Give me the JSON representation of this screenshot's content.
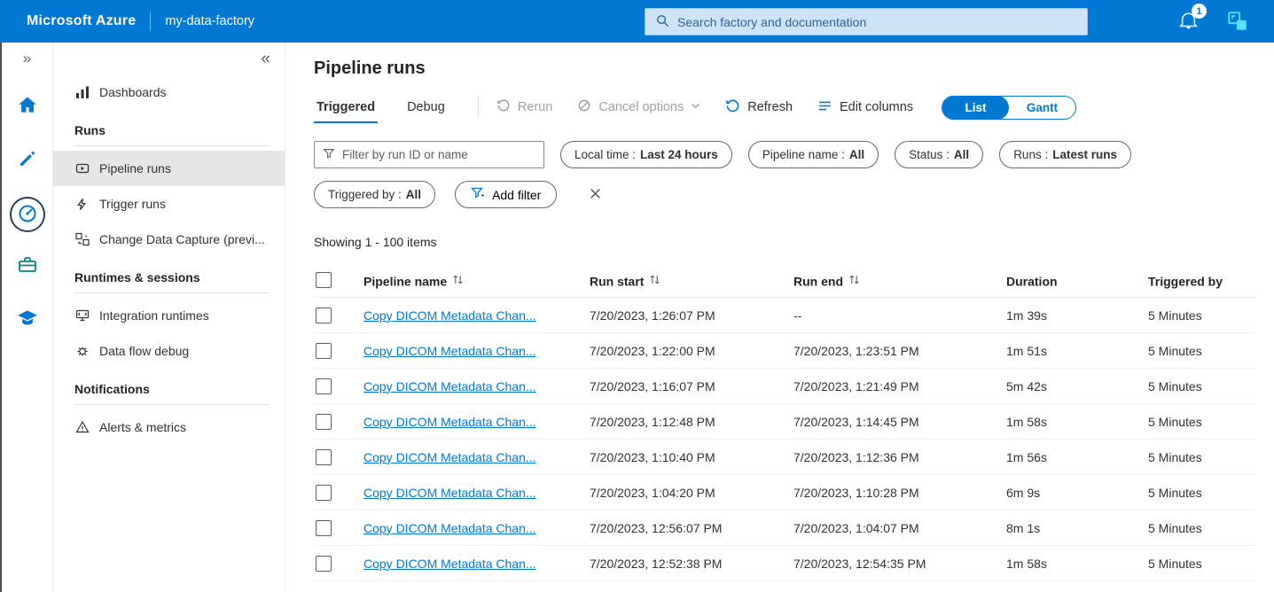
{
  "topbar": {
    "brand": "Microsoft Azure",
    "factory_name": "my-data-factory",
    "search_placeholder": "Search factory and documentation",
    "notification_badge": "1"
  },
  "icon_rail": {
    "expand_glyph": "»"
  },
  "sidebar": {
    "collapse_glyph": "«",
    "item_dashboards": "Dashboards",
    "section_runs": "Runs",
    "item_pipeline_runs": "Pipeline runs",
    "item_trigger_runs": "Trigger runs",
    "item_cdc": "Change Data Capture (previ...",
    "section_runtimes": "Runtimes & sessions",
    "item_integration_runtimes": "Integration runtimes",
    "item_data_flow_debug": "Data flow debug",
    "section_notifications": "Notifications",
    "item_alerts_metrics": "Alerts & metrics"
  },
  "main": {
    "title": "Pipeline runs",
    "tabs": {
      "triggered": "Triggered",
      "debug": "Debug"
    },
    "toolbar": {
      "rerun": "Rerun",
      "cancel_options": "Cancel options",
      "refresh": "Refresh",
      "edit_columns": "Edit columns",
      "view_list": "List",
      "view_gantt": "Gantt"
    },
    "filters": {
      "search_placeholder": "Filter by run ID or name",
      "pills": [
        {
          "label": "Local time :",
          "value": "Last 24 hours"
        },
        {
          "label": "Pipeline name :",
          "value": "All"
        },
        {
          "label": "Status :",
          "value": "All"
        },
        {
          "label": "Runs :",
          "value": "Latest runs"
        },
        {
          "label": "Triggered by :",
          "value": "All"
        }
      ],
      "add_filter": "Add filter"
    },
    "showing": "Showing 1 - 100 items",
    "table": {
      "headers": {
        "pipeline_name": "Pipeline name",
        "run_start": "Run start",
        "run_end": "Run end",
        "duration": "Duration",
        "triggered_by": "Triggered by"
      },
      "rows": [
        {
          "pipeline_name": "Copy DICOM Metadata Chan...",
          "run_start": "7/20/2023, 1:26:07 PM",
          "run_end": "--",
          "duration": "1m 39s",
          "triggered_by": "5 Minutes"
        },
        {
          "pipeline_name": "Copy DICOM Metadata Chan...",
          "run_start": "7/20/2023, 1:22:00 PM",
          "run_end": "7/20/2023, 1:23:51 PM",
          "duration": "1m 51s",
          "triggered_by": "5 Minutes"
        },
        {
          "pipeline_name": "Copy DICOM Metadata Chan...",
          "run_start": "7/20/2023, 1:16:07 PM",
          "run_end": "7/20/2023, 1:21:49 PM",
          "duration": "5m 42s",
          "triggered_by": "5 Minutes"
        },
        {
          "pipeline_name": "Copy DICOM Metadata Chan...",
          "run_start": "7/20/2023, 1:12:48 PM",
          "run_end": "7/20/2023, 1:14:45 PM",
          "duration": "1m 58s",
          "triggered_by": "5 Minutes"
        },
        {
          "pipeline_name": "Copy DICOM Metadata Chan...",
          "run_start": "7/20/2023, 1:10:40 PM",
          "run_end": "7/20/2023, 1:12:36 PM",
          "duration": "1m 56s",
          "triggered_by": "5 Minutes"
        },
        {
          "pipeline_name": "Copy DICOM Metadata Chan...",
          "run_start": "7/20/2023, 1:04:20 PM",
          "run_end": "7/20/2023, 1:10:28 PM",
          "duration": "6m 9s",
          "triggered_by": "5 Minutes"
        },
        {
          "pipeline_name": "Copy DICOM Metadata Chan...",
          "run_start": "7/20/2023, 12:56:07 PM",
          "run_end": "7/20/2023, 1:04:07 PM",
          "duration": "8m 1s",
          "triggered_by": "5 Minutes"
        },
        {
          "pipeline_name": "Copy DICOM Metadata Chan...",
          "run_start": "7/20/2023, 12:52:38 PM",
          "run_end": "7/20/2023, 12:54:35 PM",
          "duration": "1m 58s",
          "triggered_by": "5 Minutes"
        }
      ]
    }
  },
  "colors": {
    "topbar": "#0078d4",
    "accent": "#0078d4",
    "link": "#0078d4",
    "disabled": "#a19f9d",
    "sidebar_selected_bg": "#e6e6e6",
    "manage_teal": "#038387",
    "switch_cyan": "#50e6ff"
  },
  "icons": [
    "search-icon",
    "bell-icon",
    "switch-factory-icon",
    "double-chevron-right-icon",
    "double-chevron-left-icon",
    "home-icon",
    "author-pencil-icon",
    "monitor-gauge-icon",
    "manage-toolbox-icon",
    "learning-cap-icon",
    "dashboards-icon",
    "pipeline-runs-icon",
    "trigger-runs-icon",
    "cdc-icon",
    "integration-runtimes-icon",
    "data-flow-debug-icon",
    "alerts-metrics-icon",
    "rerun-icon",
    "cancel-circle-icon",
    "chevron-down-icon",
    "refresh-icon",
    "edit-columns-icon",
    "filter-funnel-icon",
    "add-filter-funnel-icon",
    "clear-x-icon",
    "sort-arrows-icon"
  ]
}
